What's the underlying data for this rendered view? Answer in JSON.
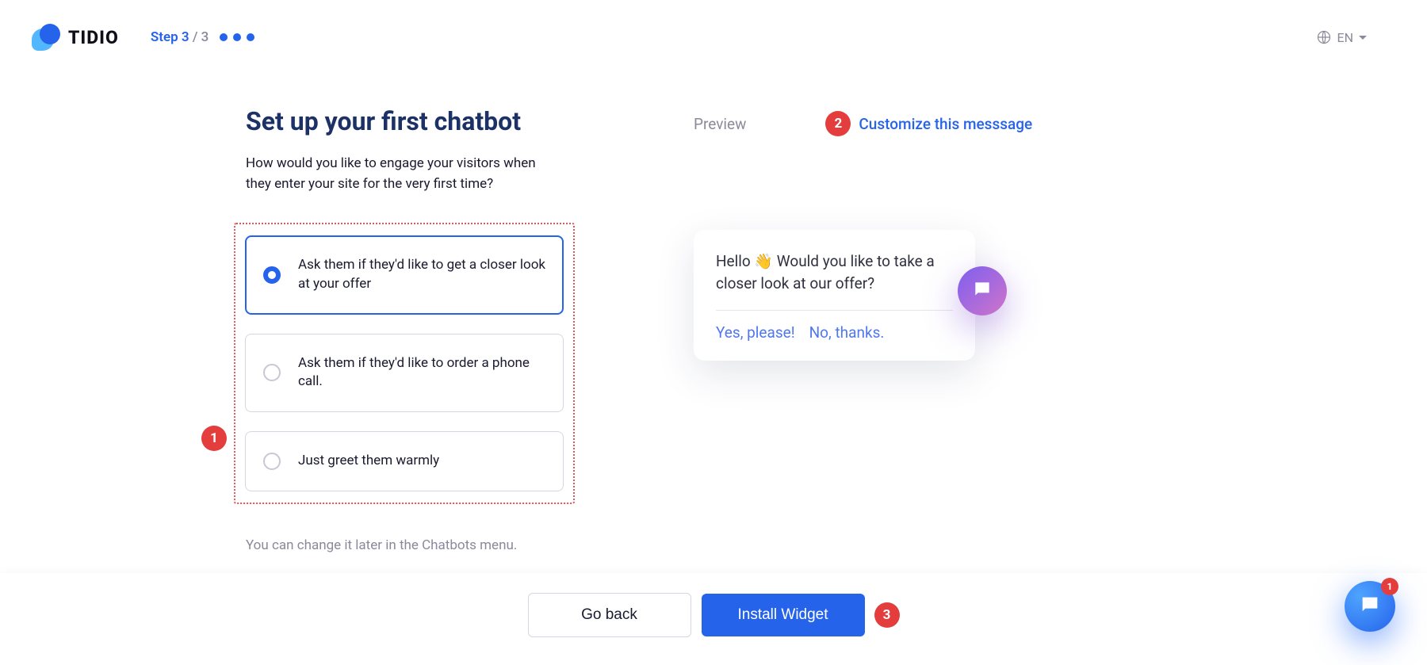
{
  "brand": {
    "name": "TIDIO"
  },
  "header": {
    "step_current": "Step 3",
    "step_total": "/ 3",
    "language": "EN"
  },
  "page": {
    "title": "Set up your first chatbot",
    "subtitle": "How would you like to engage your visitors when they enter your site for the very first time?",
    "help_note": "You can change it later in the Chatbots menu."
  },
  "options": [
    {
      "label": "Ask them if they'd like to get a closer look at your offer",
      "selected": true
    },
    {
      "label": "Ask them if they'd like to order a phone call.",
      "selected": false
    },
    {
      "label": "Just greet them warmly",
      "selected": false
    }
  ],
  "preview": {
    "label": "Preview",
    "customize_link": "Customize this messsage",
    "bubble_text": "Hello 👋 Would you like to take a closer look at our offer?",
    "action_yes": "Yes, please!",
    "action_no": "No, thanks."
  },
  "footer": {
    "back": "Go back",
    "install": "Install Widget"
  },
  "annotations": {
    "n1": "1",
    "n2": "2",
    "n3": "3"
  },
  "support": {
    "count": "1"
  }
}
